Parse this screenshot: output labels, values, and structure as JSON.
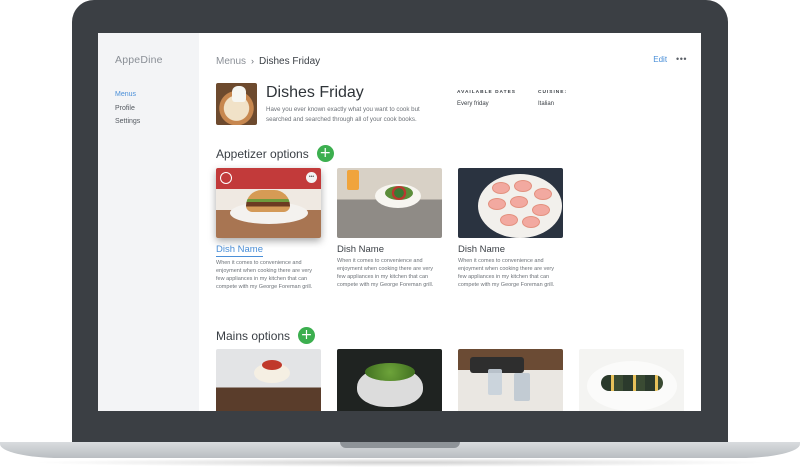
{
  "app": {
    "name": "AppeDine"
  },
  "sidebar": {
    "items": [
      {
        "label": "Menus",
        "active": true
      },
      {
        "label": "Profile",
        "active": false
      },
      {
        "label": "Settings",
        "active": false
      }
    ]
  },
  "breadcrumb": {
    "parent": "Menus",
    "separator": "›",
    "current": "Dishes Friday"
  },
  "toolbar": {
    "edit_label": "Edit",
    "more_label": "•••"
  },
  "menu": {
    "title": "Dishes Friday",
    "description": "Have you ever known exactly what you want to cook but searched and searched through all of your cook books.",
    "available_dates_label": "AVAILABLE DATES",
    "available_dates_value": "Every friday",
    "cuisine_label": "CUISINE:",
    "cuisine_value": "Italian"
  },
  "appetizers": {
    "title": "Appetizer options",
    "add_label": "+",
    "cards": [
      {
        "name": "Dish Name",
        "description": "When it comes to convenience and enjoyment when cooking there are very few appliances in my kitchen that can compete with my George Foreman grill.",
        "image": "burger-photo",
        "selected": true,
        "badge": "•••"
      },
      {
        "name": "Dish Name",
        "description": "When it comes to convenience and enjoyment when cooking there are very few appliances in my kitchen that can compete with my George Foreman grill.",
        "image": "salad-photo",
        "selected": false
      },
      {
        "name": "Dish Name",
        "description": "When it comes to convenience and enjoyment when cooking there are very few appliances in my kitchen that can compete with my George Foreman grill.",
        "image": "macaron-photo",
        "selected": false
      }
    ]
  },
  "mains": {
    "title": "Mains options",
    "add_label": "+",
    "cards": [
      {
        "image": "pudding-photo"
      },
      {
        "image": "colander-photo"
      },
      {
        "image": "drinks-photo"
      },
      {
        "image": "plated-dish-photo"
      }
    ]
  },
  "colors": {
    "accent": "#4a8fd8",
    "add_button": "#3caf4f",
    "frame": "#3b3f44",
    "sidebar_bg": "#f3f4f6"
  }
}
